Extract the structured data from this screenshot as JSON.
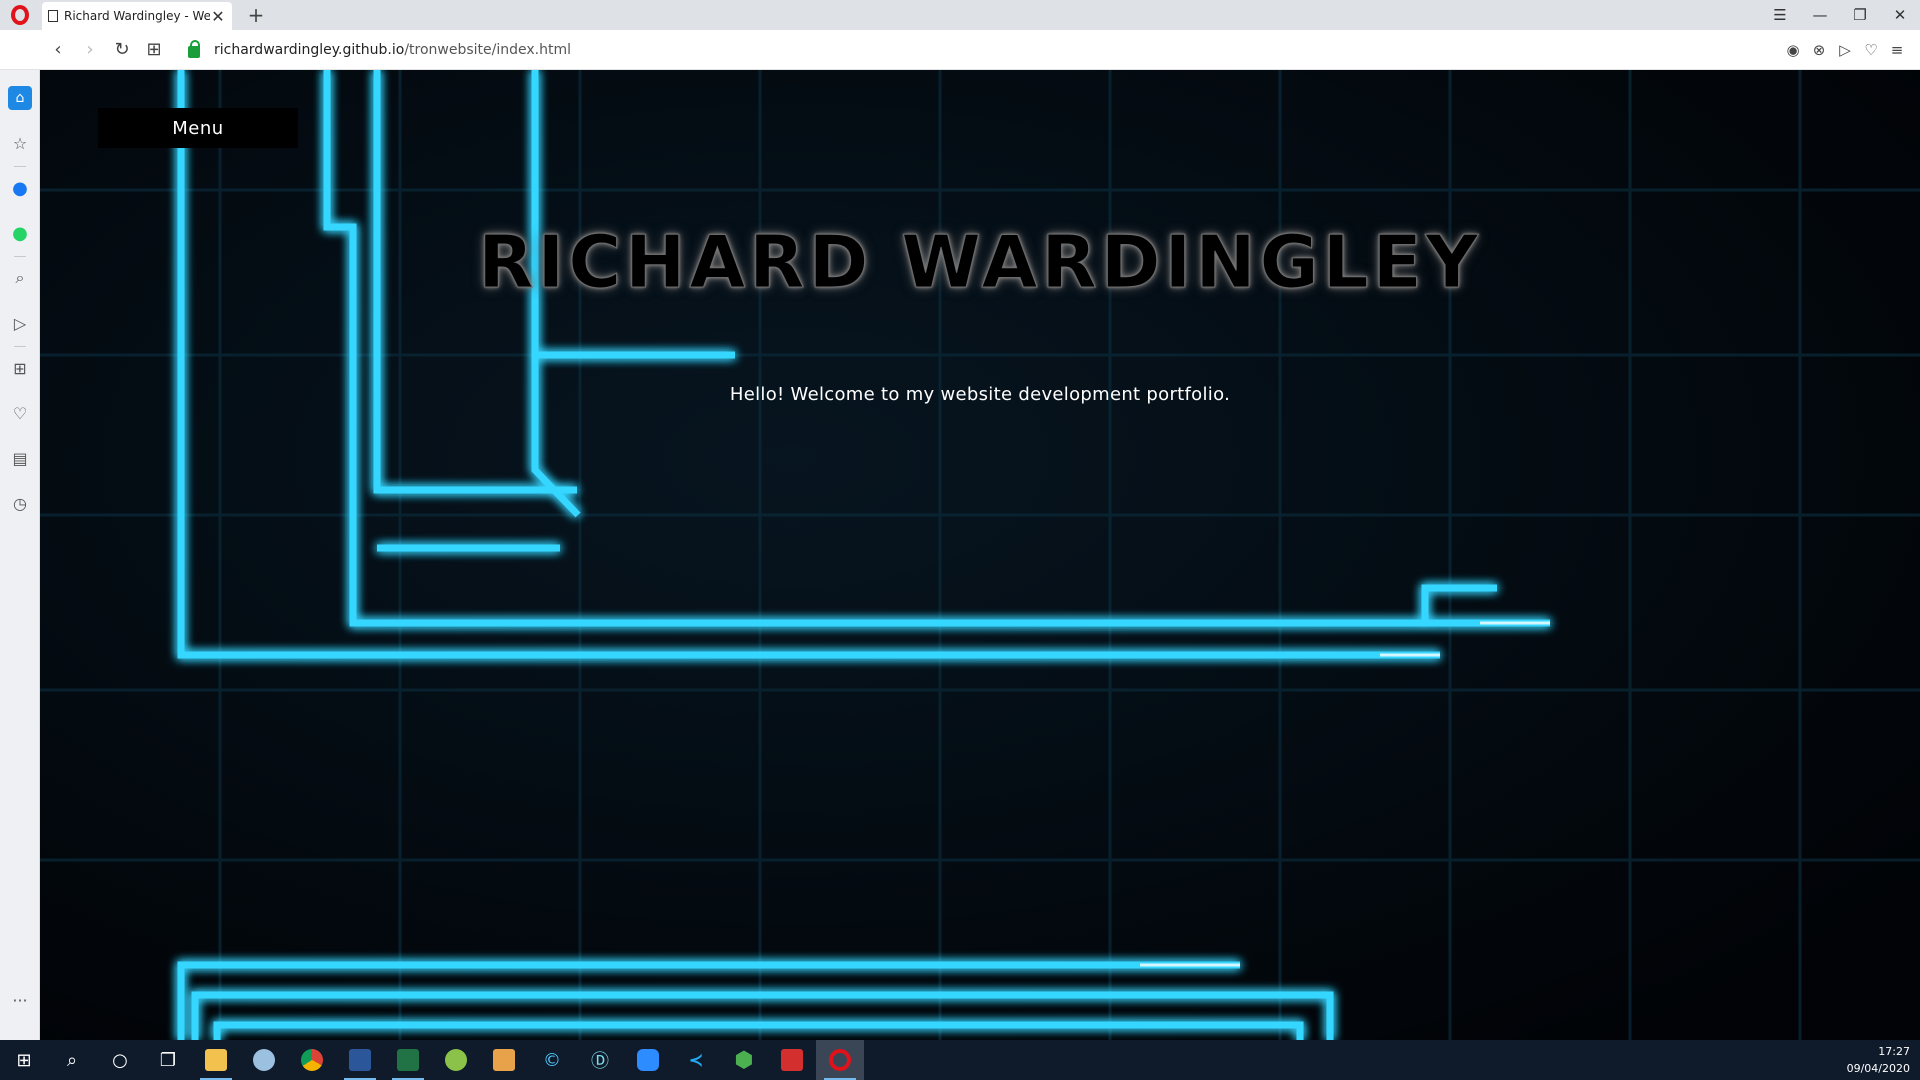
{
  "browser": {
    "tab": {
      "title": "Richard Wardingley - Webs"
    },
    "address": {
      "host": "richardwardingley.github.io",
      "path": "/tronwebsite/index.html"
    }
  },
  "page": {
    "menu_label": "Menu",
    "title": "RICHARD WARDINGLEY",
    "welcome": "Hello! Welcome to my website development portfolio."
  },
  "taskbar": {
    "time": "17:27",
    "date": "09/04/2020"
  },
  "colors": {
    "neon": "#35d6ff",
    "opera_red": "#e0131b",
    "sidebar_active": "#1e88e5"
  }
}
